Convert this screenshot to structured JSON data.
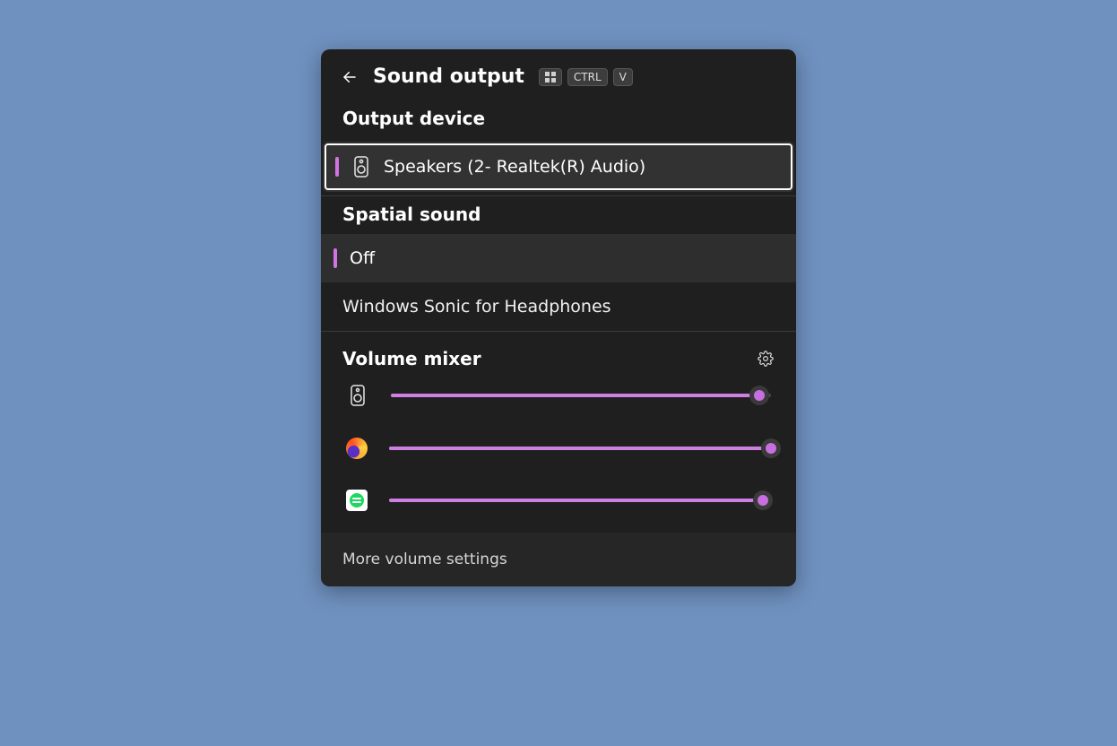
{
  "header": {
    "title": "Sound output",
    "shortcut": {
      "ctrl": "CTRL",
      "key": "V"
    }
  },
  "output_device": {
    "heading": "Output device",
    "selected": "Speakers (2- Realtek(R) Audio)"
  },
  "spatial": {
    "heading": "Spatial sound",
    "options": [
      {
        "label": "Off",
        "selected": true
      },
      {
        "label": "Windows Sonic for Headphones",
        "selected": false
      }
    ]
  },
  "mixer": {
    "heading": "Volume mixer",
    "items": [
      {
        "icon": "speaker",
        "name": "system-speaker",
        "volume": 97
      },
      {
        "icon": "firefox",
        "name": "firefox",
        "volume": 100
      },
      {
        "icon": "spotify",
        "name": "spotify",
        "volume": 98
      }
    ]
  },
  "footer": {
    "more": "More volume settings"
  },
  "colors": {
    "accent": "#cd80e2"
  }
}
